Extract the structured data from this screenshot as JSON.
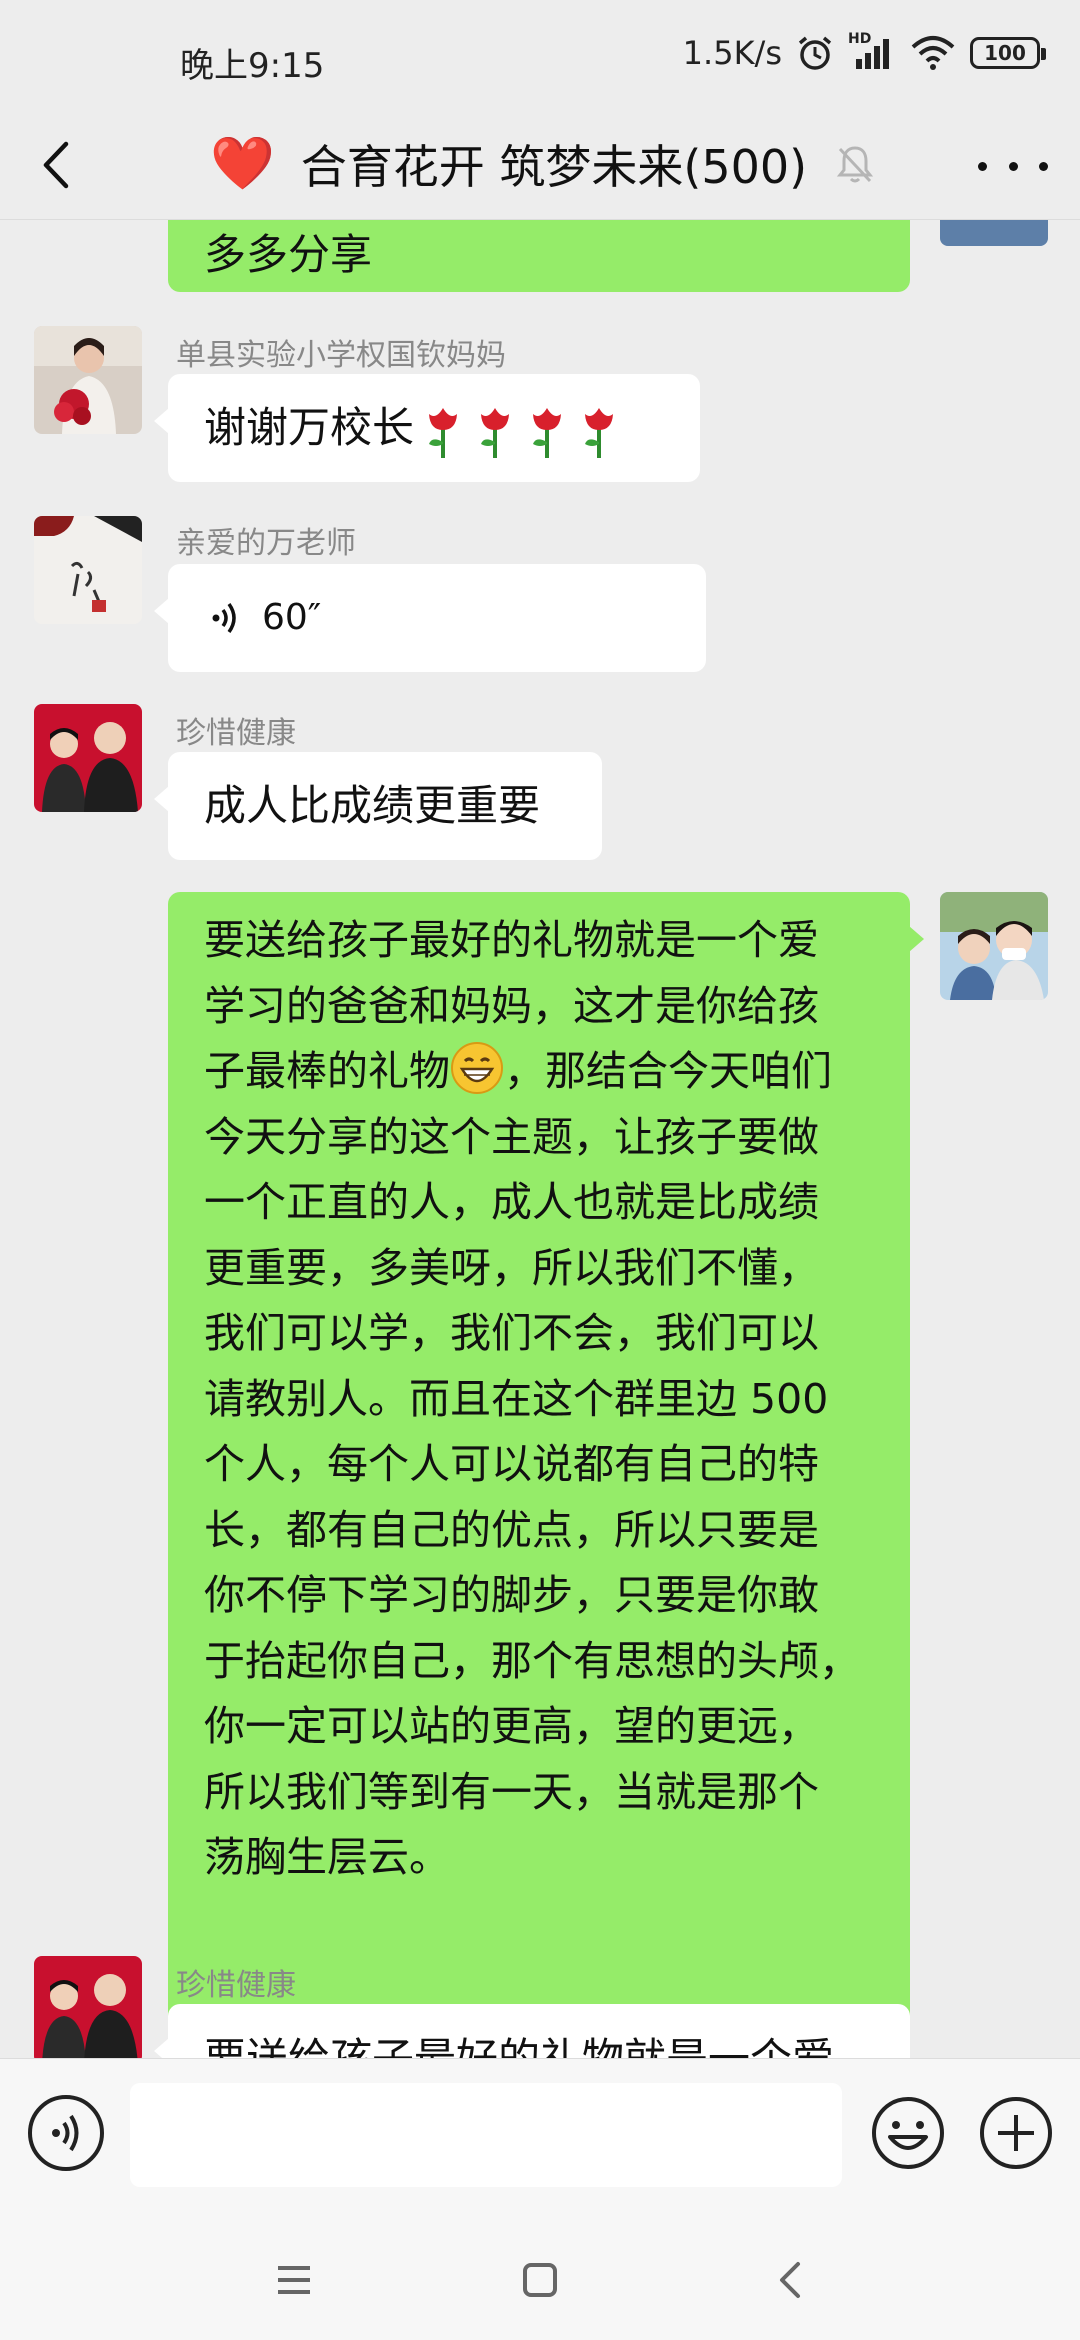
{
  "status_bar": {
    "time": "晚上9:15",
    "net_speed": "1.5K/s",
    "signal_label": "HD",
    "battery": "100"
  },
  "header": {
    "title_emoji": "❤️",
    "title": "合育花开 筑梦未来(500)"
  },
  "messages": [
    {
      "side": "right",
      "type": "text",
      "text": "多多分享"
    },
    {
      "side": "left",
      "sender": "单县实验小学权国钦妈妈",
      "type": "text",
      "text": "谢谢万校长",
      "emoji_names": [
        "rose-emoji",
        "rose-emoji",
        "rose-emoji",
        "rose-emoji"
      ]
    },
    {
      "side": "left",
      "sender": "亲爱的万老师",
      "type": "voice",
      "duration": "60″"
    },
    {
      "side": "left",
      "sender": "珍惜健康",
      "type": "text",
      "text": "成人比成绩更重要"
    },
    {
      "side": "right",
      "type": "text",
      "lines": [
        "要送给孩子最好的礼物就是一个爱",
        "学习的爸爸和妈妈，这才是你给孩",
        "子最棒的礼物",
        "，那结合今天咱们",
        "今天分享的这个主题，让孩子要做",
        "一个正直的人，成人也就是比成绩",
        "更重要，多美呀，所以我们不懂，",
        "我们可以学，我们不会，我们可以",
        "请教别人。而且在这个群里边 500",
        "个人，每个人可以说都有自己的特",
        "长，都有自己的优点，所以只要是",
        "你不停下学习的脚步，只要是你敢",
        "于抬起你自己，那个有思想的头颅，",
        "你一定可以站的更高，望的更远，",
        "所以我们等到有一天，当就是那个",
        "荡胸生层云。"
      ]
    },
    {
      "side": "left",
      "sender": "珍惜健康",
      "type": "text",
      "text": "要送给孩子最好的礼物就是一个爱"
    }
  ],
  "input": {
    "value": ""
  },
  "colors": {
    "bubble_self": "#95ec69",
    "bubble_other": "#ffffff",
    "background": "#ededed"
  }
}
